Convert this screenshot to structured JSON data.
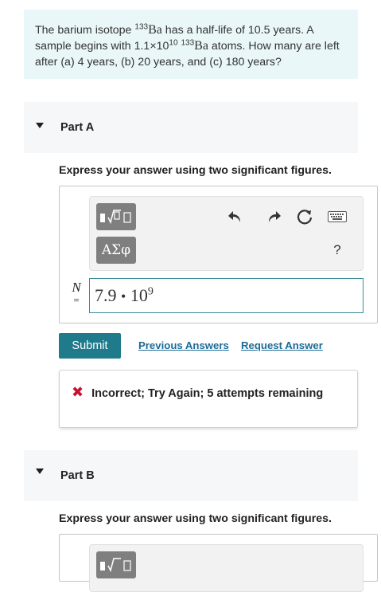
{
  "question": {
    "text_1": "The barium isotope ",
    "isotope_mass": "133",
    "element": "Ba",
    "text_2": " has a half-life of 10.5 years. A sample begins with 1.1×10",
    "exponent": "10",
    "isotope_mass_2": "133",
    "element_2": "Ba",
    "text_3": " atoms. How many are left after (a) 4 years, (b) 20 years, and (c) 180 years?"
  },
  "part_a": {
    "title": "Part A",
    "instruction": "Express your answer using two significant figures.",
    "toolbar": {
      "templates_icon": "templates-icon",
      "greek_label": "ΑΣφ",
      "undo_icon": "undo-icon",
      "redo_icon": "redo-icon",
      "reset_icon": "reset-icon",
      "keyboard_icon": "keyboard-icon",
      "help_label": "?"
    },
    "variable": "N",
    "equals": "=",
    "answer_mantissa": "7.9",
    "answer_dot": "•",
    "answer_base": "10",
    "answer_exponent": "9",
    "submit_label": "Submit",
    "previous_answers_label": "Previous Answers",
    "request_answer_label": "Request Answer",
    "feedback": {
      "icon": "x-icon",
      "text": "Incorrect; Try Again; 5 attempts remaining"
    }
  },
  "part_b": {
    "title": "Part B",
    "instruction": "Express your answer using two significant figures."
  },
  "colors": {
    "question_bg": "#e9f7f8",
    "part_header_bg": "#f6f7f8",
    "submit_bg": "#1f7a8c",
    "link": "#1a6b96",
    "error": "#c8102e",
    "input_border": "#3b8b96"
  }
}
